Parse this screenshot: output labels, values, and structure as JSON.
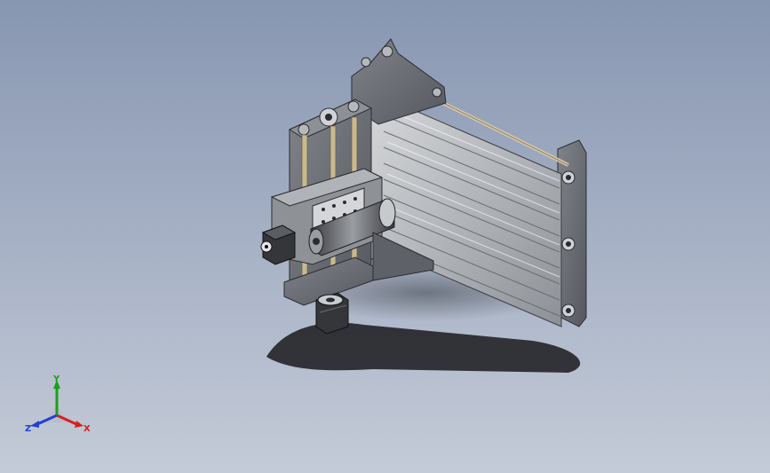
{
  "viewport": {
    "background_top": "#8796b1",
    "background_bottom": "#c4cbd8"
  },
  "model": {
    "metal_color": "#6e7278",
    "rail_color": "#b9bcc1",
    "dark_color": "#2a2c30"
  },
  "triad": {
    "x_label": "X",
    "y_label": "Y",
    "z_label": "Z",
    "x_color": "#d62020",
    "y_color": "#1aa01a",
    "z_color": "#2040d0"
  }
}
